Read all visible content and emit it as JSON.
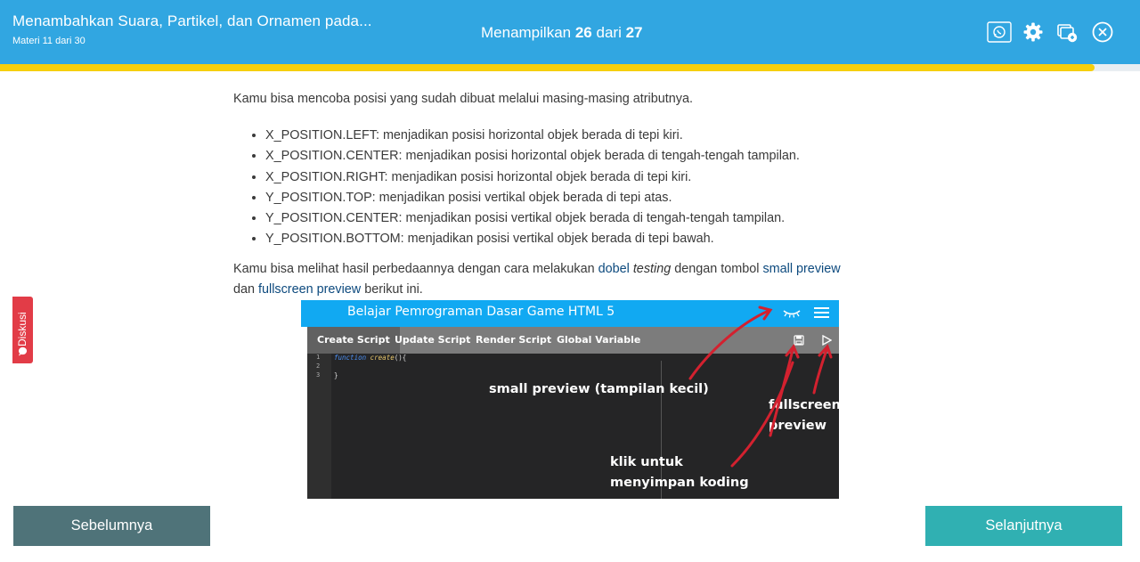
{
  "header": {
    "title": "Menambahkan Suara, Partikel, dan Ornamen pada...",
    "subtitle": "Materi 11 dari 30",
    "counter_prefix": "Menampilkan",
    "counter_current": "26",
    "counter_mid": "dari",
    "counter_total": "27",
    "icons": [
      "whatsapp-icon",
      "gear-icon",
      "windows-plus-icon",
      "close-circle-icon"
    ],
    "progress": 0.96,
    "colors": {
      "header": "#31a6e1",
      "progress": "#f6cf0c"
    }
  },
  "content": {
    "intro": "Kamu bisa mencoba posisi yang sudah dibuat melalui masing-masing atributnya.",
    "items": [
      "X_POSITION.LEFT:  menjadikan posisi horizontal objek berada di tepi kiri.",
      "X_POSITION.CENTER:  menjadikan posisi horizontal objek berada di tengah-tengah tampilan.",
      "X_POSITION.RIGHT:  menjadikan posisi horizontal objek berada di tepi kiri.",
      "Y_POSITION.TOP:  menjadikan posisi vertikal objek berada di tepi atas.",
      "Y_POSITION.CENTER:  menjadikan posisi vertikal objek berada di tengah-tengah tampilan.",
      "Y_POSITION.BOTTOM:  menjadikan posisi vertikal objek berada di tepi bawah."
    ],
    "para2": {
      "part1": "Kamu bisa melihat hasil perbedaannya dengan cara melakukan ",
      "bold1": "dobel",
      "em": "testing",
      "part2": " dengan tombol ",
      "bold2": "small preview",
      "part3": "dan ",
      "bold3": "fullscreen preview",
      "part4": " berikut ini."
    }
  },
  "side_tab": {
    "label": "Diskusi",
    "icon": "chat-icon"
  },
  "screenshot": {
    "title": "Belajar Pemrograman Dasar Game HTML 5",
    "tabs": [
      "Create Script",
      "Update Script",
      "Render Script",
      "Global Variable"
    ],
    "line_numbers": [
      "1",
      "2",
      "3"
    ],
    "code": {
      "line1_kw": "function",
      "line1_fn": "create",
      "line1_rest": "(){",
      "line3": "}"
    },
    "labels": {
      "small_preview": "small preview (tampilan kecil)",
      "fullscreen1": "fullscreen",
      "fullscreen2": "preview",
      "save1": "klik untuk",
      "save2": "menyimpan koding"
    },
    "icons": [
      "eye-icon",
      "menu-icon",
      "save-icon",
      "play-icon"
    ]
  },
  "footer": {
    "prev_label": "Sebelumnya",
    "next_label": "Selanjutnya"
  }
}
